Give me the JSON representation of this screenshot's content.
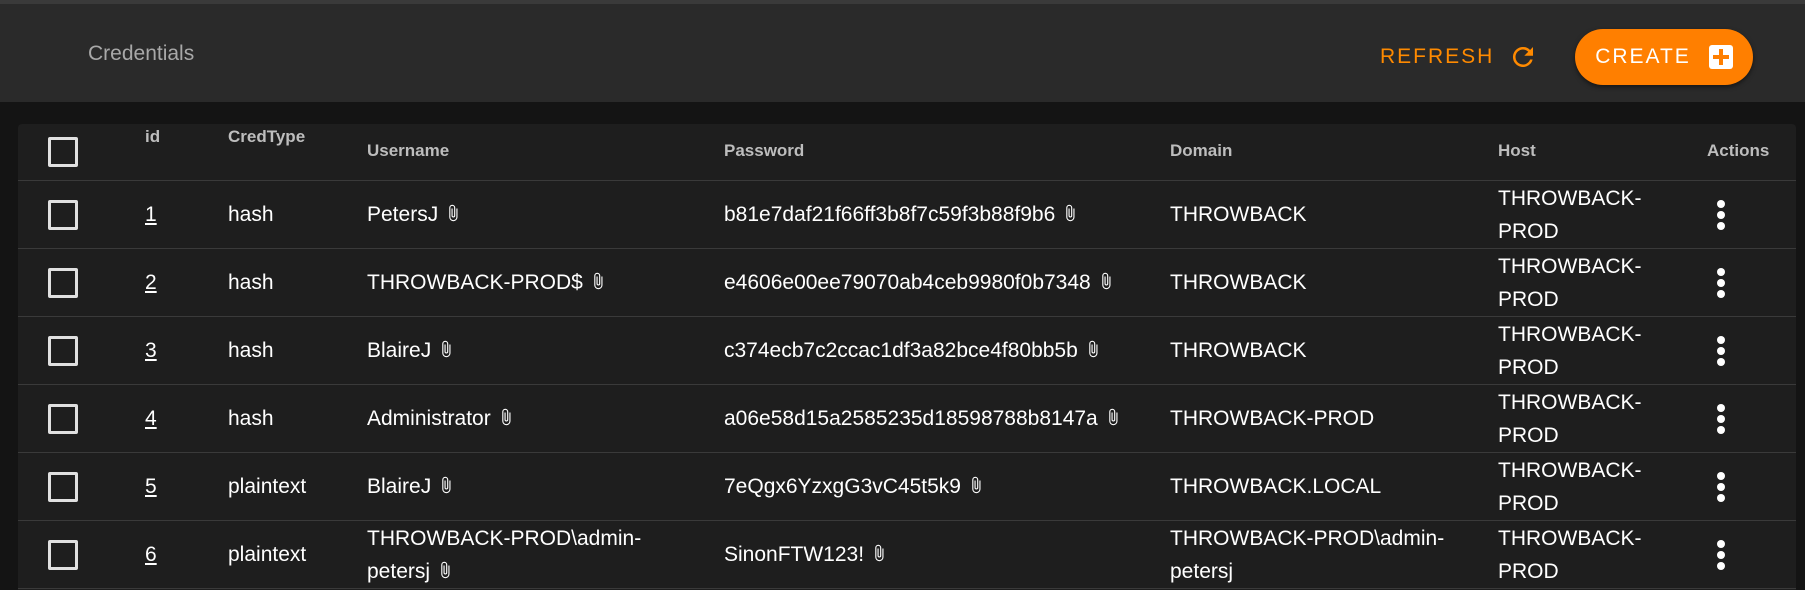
{
  "header": {
    "title": "Credentials",
    "refresh_label": "REFRESH",
    "create_label": "CREATE",
    "accent_color": "#ff7f00"
  },
  "table": {
    "columns": {
      "id": "id",
      "credtype": "CredType",
      "username": "Username",
      "password": "Password",
      "domain": "Domain",
      "host": "Host",
      "actions": "Actions"
    },
    "rows": [
      {
        "id": "1",
        "credtype": "hash",
        "username": "PetersJ",
        "password": "b81e7daf21f66ff3b8f7c59f3b88f9b6",
        "domain": "THROWBACK",
        "host": "THROWBACK-PROD"
      },
      {
        "id": "2",
        "credtype": "hash",
        "username": "THROWBACK-PROD$",
        "password": "e4606e00ee79070ab4ceb9980f0b7348",
        "domain": "THROWBACK",
        "host": "THROWBACK-PROD"
      },
      {
        "id": "3",
        "credtype": "hash",
        "username": "BlaireJ",
        "password": "c374ecb7c2ccac1df3a82bce4f80bb5b",
        "domain": "THROWBACK",
        "host": "THROWBACK-PROD"
      },
      {
        "id": "4",
        "credtype": "hash",
        "username": "Administrator",
        "password": "a06e58d15a2585235d18598788b8147a",
        "domain": "THROWBACK-PROD",
        "host": "THROWBACK-PROD"
      },
      {
        "id": "5",
        "credtype": "plaintext",
        "username": "BlaireJ",
        "password": "7eQgx6YzxgG3vC45t5k9",
        "domain": "THROWBACK.LOCAL",
        "host": "THROWBACK-PROD"
      },
      {
        "id": "6",
        "credtype": "plaintext",
        "username": "THROWBACK-PROD\\admin-petersj",
        "password": "SinonFTW123!",
        "domain": "THROWBACK-PROD\\admin-petersj",
        "host": "THROWBACK-PROD"
      }
    ]
  },
  "icons": {
    "refresh": "refresh-icon",
    "create": "add-box-icon",
    "copy": "paperclip-icon",
    "row_menu": "more-vert-icon"
  }
}
